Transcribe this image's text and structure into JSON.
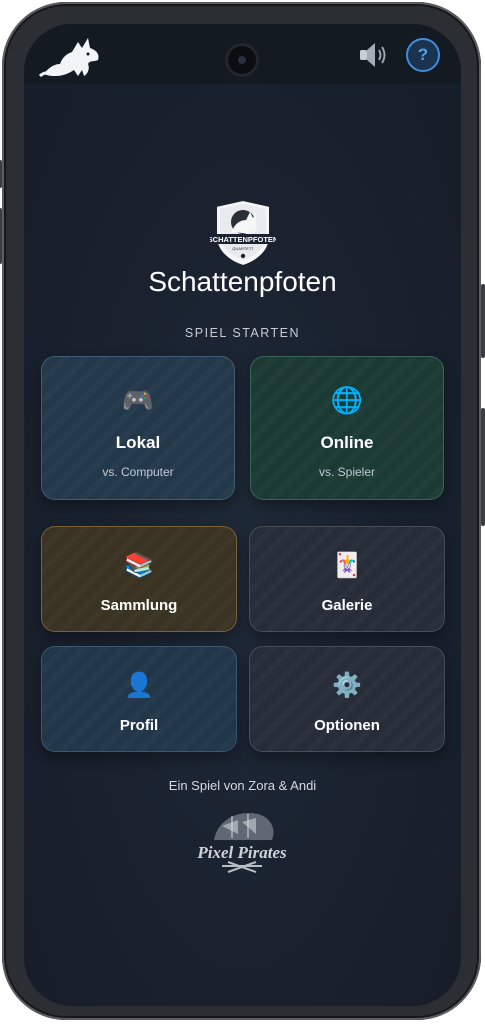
{
  "app": {
    "title": "Schattenpfoten",
    "crest_text": "SCHATTENPFOTEN",
    "crest_subtext": "QUARTETT"
  },
  "header": {
    "logo_icon": "wolf-icon",
    "sound_icon": "speaker-icon",
    "help_label": "?"
  },
  "menu": {
    "section_label": "SPIEL STARTEN",
    "play_modes": [
      {
        "label": "Lokal",
        "sub": "vs. Computer",
        "icon": "🎮"
      },
      {
        "label": "Online",
        "sub": "vs. Spieler",
        "icon": "🌐"
      }
    ],
    "items": [
      {
        "label": "Sammlung",
        "icon": "📚"
      },
      {
        "label": "Galerie",
        "icon": "🃏"
      },
      {
        "label": "Profil",
        "icon": "👤"
      },
      {
        "label": "Optionen",
        "icon": "⚙️"
      }
    ]
  },
  "footer": {
    "credit": "Ein Spiel von Zora & Andi",
    "studio_logo_text": "Pixel Pirates"
  },
  "colors": {
    "accent": "#3f8edc",
    "background": "#1a2230"
  }
}
